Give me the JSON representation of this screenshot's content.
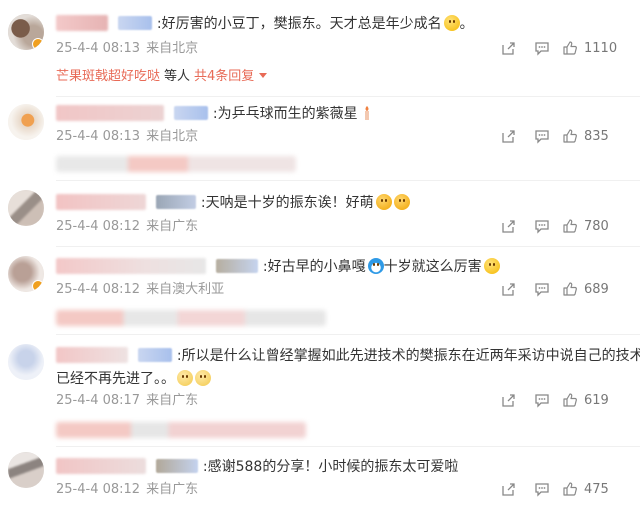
{
  "comments": [
    {
      "text": ":好厉害的小豆丁，樊振东。天才总是年少成名",
      "date": "25-4-4 08:13",
      "location": "来自北京",
      "likes": "1110",
      "replies": {
        "name": "芒果斑戟超好吃哒",
        "sep": "等人",
        "more": "共4条回复"
      }
    },
    {
      "text": ":为乒乓球而生的紫薇星",
      "date": "25-4-4 08:13",
      "location": "来自北京",
      "likes": "835"
    },
    {
      "text": ":天呐是十岁的振东诶！好萌",
      "date": "25-4-4 08:12",
      "location": "来自广东",
      "likes": "780"
    },
    {
      "text": ":好古早的小鼻嘎",
      "text2": "十岁就这么厉害",
      "date": "25-4-4 08:12",
      "location": "来自澳大利亚",
      "likes": "689"
    },
    {
      "text": ":所以是什么让曾经掌握如此先进技术的樊振东在近两年采访中说自己的技术",
      "text_line2": "已经不再先进了。。",
      "date": "25-4-4 08:17",
      "location": "来自广东",
      "likes": "619"
    },
    {
      "text": ":感谢588的分享！小时候的振东太可爱啦",
      "date": "25-4-4 08:12",
      "location": "来自广东",
      "likes": "475"
    }
  ],
  "icons": {
    "share": "share-icon",
    "comment": "comment-icon",
    "like": "like-icon"
  },
  "colors": {
    "reply_accent": "#e86a56",
    "meta_gray": "#999999"
  }
}
